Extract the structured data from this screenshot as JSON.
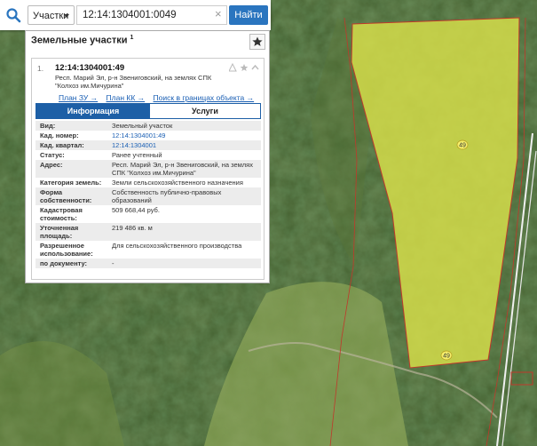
{
  "search": {
    "type_label": "Участки",
    "query": "12:14:1304001:0049",
    "find_label": "Найти"
  },
  "panel": {
    "title": "Земельные участки",
    "count": "1"
  },
  "item": {
    "index": "1.",
    "number": "12:14:1304001:49",
    "address_line1": "Респ. Марий Эл, р-н Звениговский, на землях СПК",
    "address_line2": "\"Колхоз им.Мичурина\"",
    "links": [
      "План ЗУ →",
      "План КК →",
      "Поиск в границах объекта →"
    ]
  },
  "tabs": {
    "info": "Информация",
    "services": "Услуги"
  },
  "rows": [
    {
      "label": "Вид:",
      "value": "Земельный участок"
    },
    {
      "label": "Кад. номер:",
      "value": "12:14:1304001:49",
      "link": true
    },
    {
      "label": "Кад. квартал:",
      "value": "12:14:1304001",
      "link": true
    },
    {
      "label": "Статус:",
      "value": "Ранее учтенный"
    },
    {
      "label": "Адрес:",
      "value": "Респ. Марий Эл, р-н Звениговский, на землях СПК \"Колхоз им.Мичурина\""
    },
    {
      "label": "Категория земель:",
      "value": "Земли сельскохозяйственного назначения"
    },
    {
      "label": "Форма собственности:",
      "value": "Собственность публично-правовых образований"
    },
    {
      "label": "Кадастровая стоимость:",
      "value": "509 668,44 руб."
    },
    {
      "label": "Уточненная площадь:",
      "value": "219 486 кв. м"
    },
    {
      "label": "Разрешенное использование:",
      "value": "Для сельскохозяйственного производства"
    },
    {
      "label": "по документу:",
      "value": "-"
    }
  ],
  "map": {
    "parcel_label_1": "49",
    "parcel_label_2": "49",
    "colors": {
      "parcel_fill": "#d9e04a",
      "parcel_border": "#c0392b",
      "forest_dark": "#2f4a22",
      "field": "#6e8f3c",
      "accent": "#2a75bf"
    }
  }
}
